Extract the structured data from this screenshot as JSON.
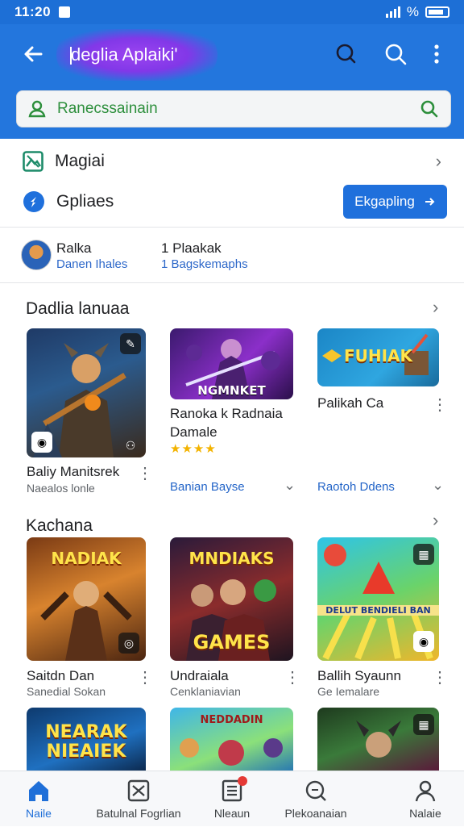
{
  "status": {
    "time": "11:20",
    "battery": "%"
  },
  "header": {
    "title": "deglia Aplaiki'",
    "search_value": "Ranecssainain"
  },
  "menu": {
    "item1": "Magiai",
    "item2": "Gpliaes",
    "button": "Ekgapling"
  },
  "account": {
    "name": "Ralka",
    "sub": "Danen Ihales",
    "num": "1 Plaakak",
    "num_sub": "1 Bagskemaphs"
  },
  "section1": {
    "title": "Dadlia lanuaa",
    "apps": [
      {
        "name": "Baliy Manitsrek",
        "sub": "Naealos lonle"
      },
      {
        "art": "NGMNKET",
        "name_line1": "Ranoka k Radnaia",
        "name_line2": "Damale",
        "stars": "★★★★",
        "link": "Banian Bayse"
      },
      {
        "art": "FUHIAK",
        "name": "Palikah Ca",
        "link": "Raotoh Ddens"
      }
    ]
  },
  "section2": {
    "title": "Kachana",
    "apps": [
      {
        "art": "NADIAK",
        "name": "Saitdn Dan",
        "sub": "Sanedial Sokan"
      },
      {
        "art1": "MNDIAKS",
        "art2": "GAMES",
        "name": "Undraiala",
        "sub": "Cenklaniavian"
      },
      {
        "art": "DELUT BENDIELI BAN",
        "name": "Ballih Syaunn",
        "sub": "Ge Iemalare"
      }
    ]
  },
  "section3": {
    "apps": [
      {
        "art1": "NEARAK",
        "art2": "NIEAIEK"
      },
      {
        "art": "NEDDADIN"
      },
      {
        "art": ""
      }
    ]
  },
  "nav": [
    {
      "label": "Naile",
      "icon": "home-icon",
      "active": true
    },
    {
      "label": "Batulnal Fogrlian",
      "icon": "games-icon"
    },
    {
      "label": "Nleaun",
      "icon": "news-icon"
    },
    {
      "label": "Plekoanaian",
      "icon": "discover-icon"
    },
    {
      "label": "Nalaie",
      "icon": "profile-icon"
    }
  ],
  "colors": {
    "primary": "#2376dd",
    "accent_green": "#2d8f3c",
    "link": "#2465c8",
    "star": "#f3b300"
  }
}
